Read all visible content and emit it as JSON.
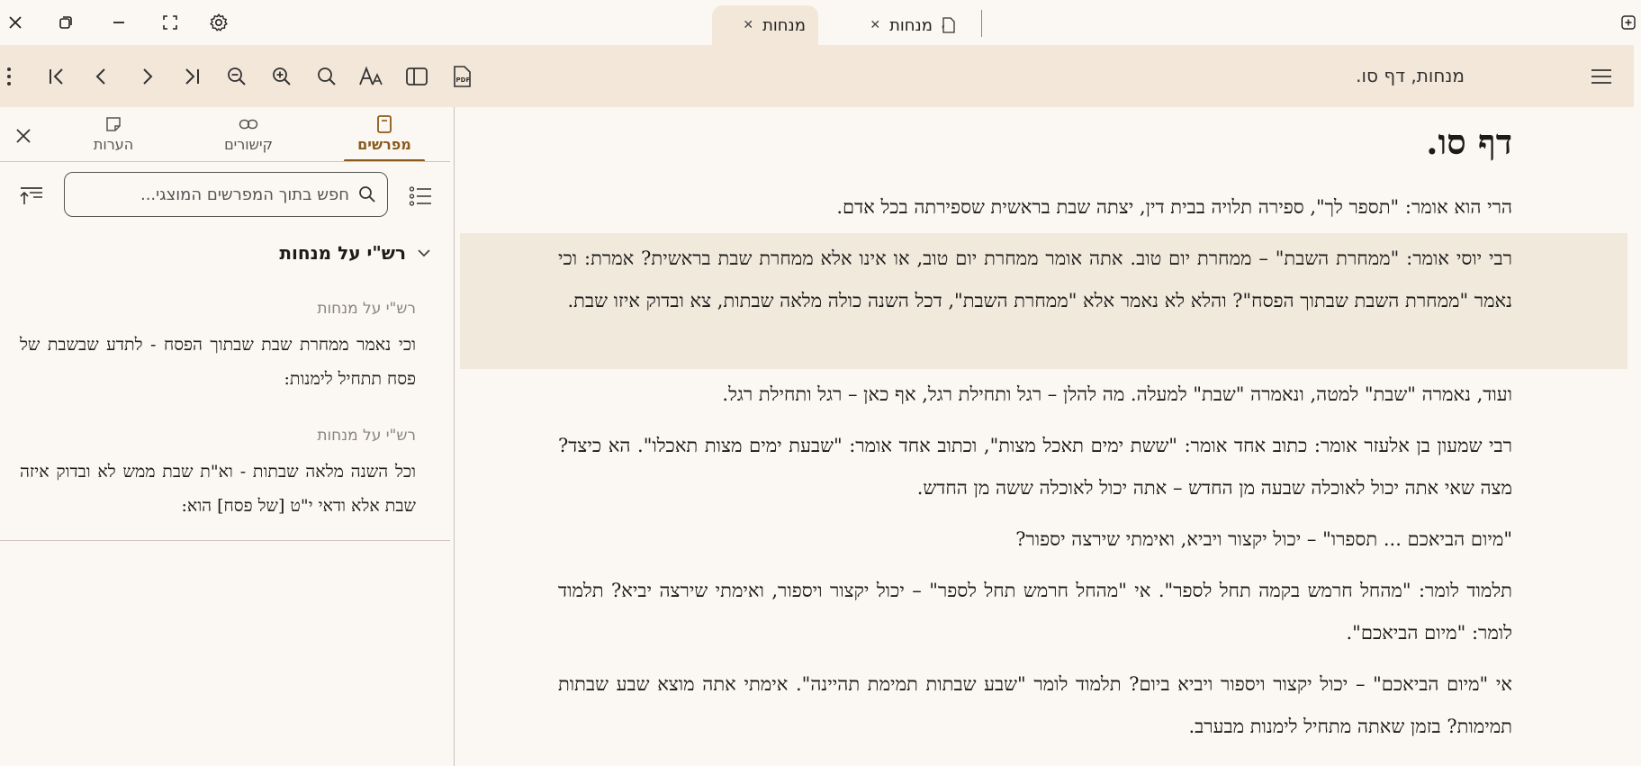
{
  "titlebar": {
    "tabs": [
      {
        "label": "מנחות",
        "active": true,
        "has_pdf_icon": false
      },
      {
        "label": "מנחות",
        "active": false,
        "has_pdf_icon": true
      }
    ],
    "window_controls": [
      "close-icon",
      "restore-icon",
      "minimize-icon",
      "fullscreen-icon",
      "settings-icon"
    ]
  },
  "toolbar": {
    "book_title": "מנחות, דף סו.",
    "buttons": [
      "more-vertical-icon",
      "first-page-icon",
      "previous-icon",
      "next-icon",
      "last-page-icon",
      "zoom-out-icon",
      "zoom-in-icon",
      "search-icon",
      "font-size-icon",
      "toggle-panel-icon",
      "pdf-icon"
    ]
  },
  "side_panel": {
    "tabs": [
      {
        "label": "מפרשים",
        "icon": "book-icon",
        "active": true
      },
      {
        "label": "קישורים",
        "icon": "link-icon",
        "active": false
      },
      {
        "label": "הערות",
        "icon": "note-icon",
        "active": false
      }
    ],
    "search_placeholder": "חפש בתוך המפרשים המוצגי...",
    "commentary_group": "רש\"י על מנחות",
    "entries": [
      {
        "source": "רש\"י על מנחות",
        "text": "וכי נאמר ממחרת שבת שבתוך הפסח - לתדע שבשבת של פסח תתחיל לימנות:"
      },
      {
        "source": "רש\"י על מנחות",
        "text": "וכל השנה מלאה שבתות - וא\"ת שבת ממש לא ובדוק איזה שבת אלא ודאי י\"ט [של פסח] הוא:"
      }
    ]
  },
  "main": {
    "heading": "דף סו.",
    "paragraphs": [
      "הרי הוא אומר: \"תספר לך\", ספירה תלויה בבית דין, יצתה שבת בראשית שספירתה בכל אדם.",
      "רבי יוסי אומר: \"ממחרת השבת\" – ממחרת יום טוב. אתה אומר ממחרת יום טוב, או אינו אלא ממחרת שבת בראשית? אמרת: וכי נאמר \"ממחרת השבת שבתוך הפסח\"? והלא לא נאמר אלא \"ממחרת השבת\", דכל השנה כולה מלאה שבתות, צא ובדוק איזו שבת.",
      "ועוד, נאמרה \"שבת\" למטה, ונאמרה \"שבת\" למעלה. מה להלן – רגל ותחילת רגל, אף כאן – רגל ותחילת רגל.",
      "רבי שמעון בן אלעזר אומר: כתוב אחד אומר: \"ששת ימים תאכל מצות\", וכתוב אחד אומר: \"שבעת ימים מצות תאכלו\". הא כיצד? מצה שאי אתה יכול לאוכלה שבעה מן החדש – אתה יכול לאוכלה ששה מן החדש.",
      "\"מיום הביאכם ... תספרו\" – יכול יקצור ויביא, ואימתי שירצה יספור?",
      "תלמוד לומר: \"מהחל חרמש בקמה תחל לספר\". אי \"מהחל חרמש תחל לספר\" – יכול יקצור ויספור, ואימתי שירצה יביא? תלמוד לומר: \"מיום הביאכם\".",
      "אי \"מיום הביאכם\" – יכול יקצור ויספור ויביא ביום? תלמוד לומר \"שבע שבתות תמימת תהיינה\". אימתי אתה מוצא שבע שבתות תמימות? בזמן שאתה מתחיל לימנות מבערב."
    ]
  }
}
